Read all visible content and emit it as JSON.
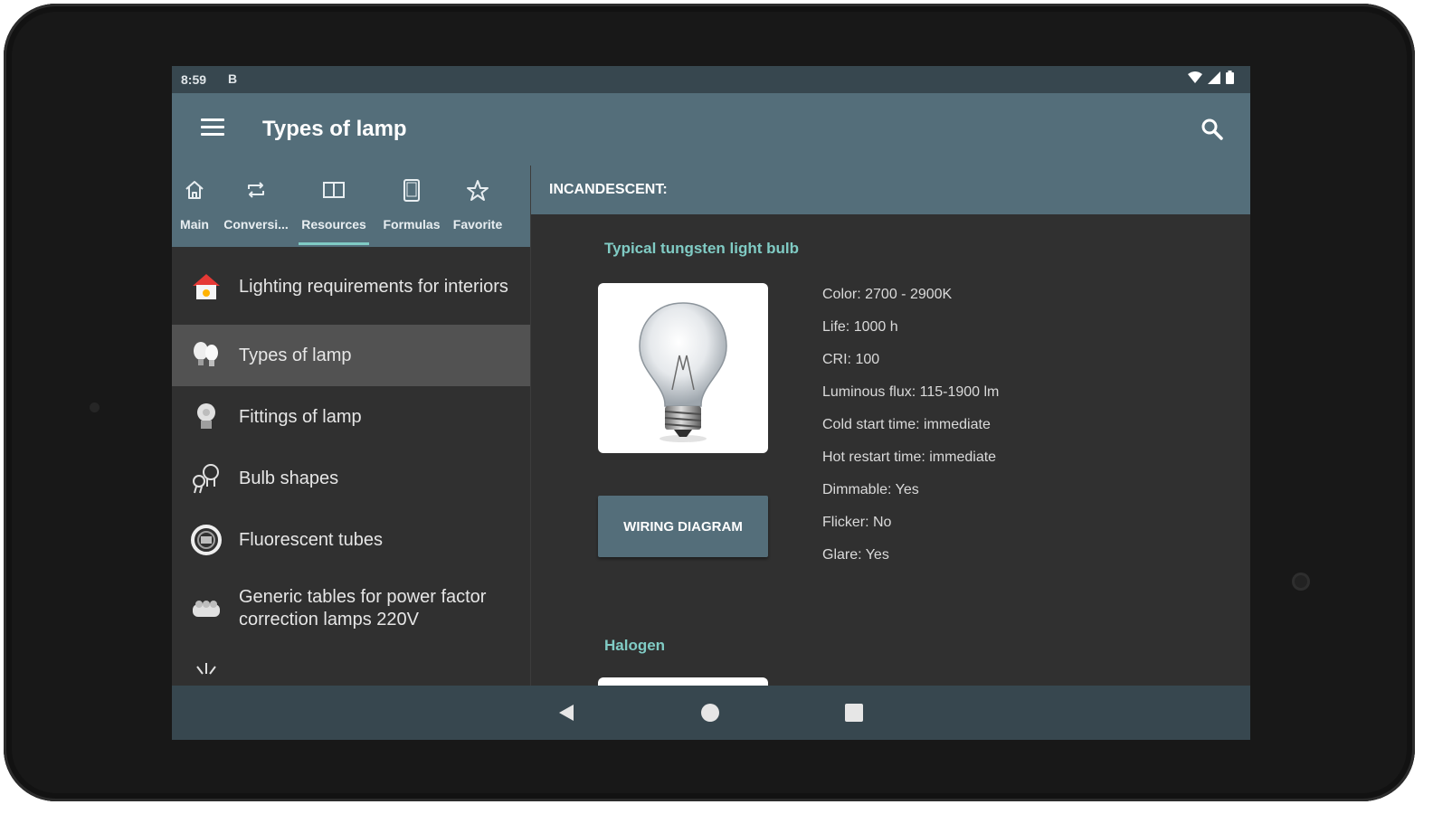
{
  "status": {
    "time": "8:59",
    "notification": "B"
  },
  "appbar": {
    "title": "Types of lamp"
  },
  "tabs": [
    {
      "label": "Main",
      "icon": "home-icon"
    },
    {
      "label": "Conversi...",
      "icon": "repeat-icon"
    },
    {
      "label": "Resources",
      "icon": "book-icon"
    },
    {
      "label": "Formulas",
      "icon": "tablet-icon"
    },
    {
      "label": "Favorite",
      "icon": "star-icon"
    }
  ],
  "active_tab": "Resources",
  "menu_items": [
    {
      "label": "Lighting requirements for interiors",
      "icon": "house-lamp-icon"
    },
    {
      "label": "Types of lamp",
      "icon": "lamps-icon",
      "selected": true
    },
    {
      "label": "Fittings of lamp",
      "icon": "lamp-fitting-icon"
    },
    {
      "label": "Bulb shapes",
      "icon": "bulb-shapes-icon"
    },
    {
      "label": "Fluorescent tubes",
      "icon": "fluorescent-tube-icon"
    },
    {
      "label": "Generic tables for power factor correction lamps 220V",
      "icon": "capacitor-icon"
    }
  ],
  "detail": {
    "section_title": "INCANDESCENT:",
    "lamp": {
      "name": "Typical tungsten light bulb",
      "button": "WIRING DIAGRAM",
      "specs": [
        "Color: 2700 - 2900K",
        "Life: 1000 h",
        "CRI: 100",
        "Luminous flux: 115-1900 lm",
        "Cold start time: immediate",
        "Hot restart time: immediate",
        "Dimmable: Yes",
        "Flicker: No",
        "Glare: Yes"
      ]
    },
    "next_lamp": {
      "name": "Halogen"
    }
  },
  "colors": {
    "primary": "#546e7a",
    "primary_dark": "#37474f",
    "accent": "#80cbc4",
    "background": "#303030",
    "selected": "#525252"
  }
}
